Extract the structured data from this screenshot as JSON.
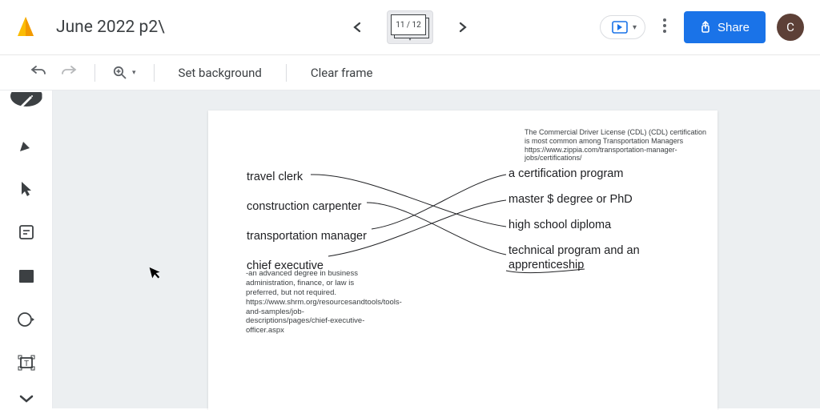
{
  "header": {
    "doc_title": "June 2022 p2\\",
    "slide_counter": "11 / 12",
    "share_label": "Share",
    "avatar_letter": "C"
  },
  "toolbar": {
    "set_bg": "Set background",
    "clear_frame": "Clear frame"
  },
  "slide": {
    "left_items": [
      "travel clerk",
      "construction carpenter",
      "transportation manager",
      "chief executive"
    ],
    "right_items": [
      "a certification program",
      "master $ degree or PhD",
      "high school diploma",
      "technical program and an apprenticeship"
    ],
    "note_top": "The Commercial Driver License (CDL) (CDL) certification is most common among Transportation Managers https://www.zippia.com/transportation-manager-jobs/certifications/",
    "note_bottom": "-an advanced degree in business administration, finance, or law is preferred, but not required. https://www.shrm.org/resourcesandtools/tools-and-samples/job-descriptions/pages/chief-executive-officer.aspx"
  }
}
